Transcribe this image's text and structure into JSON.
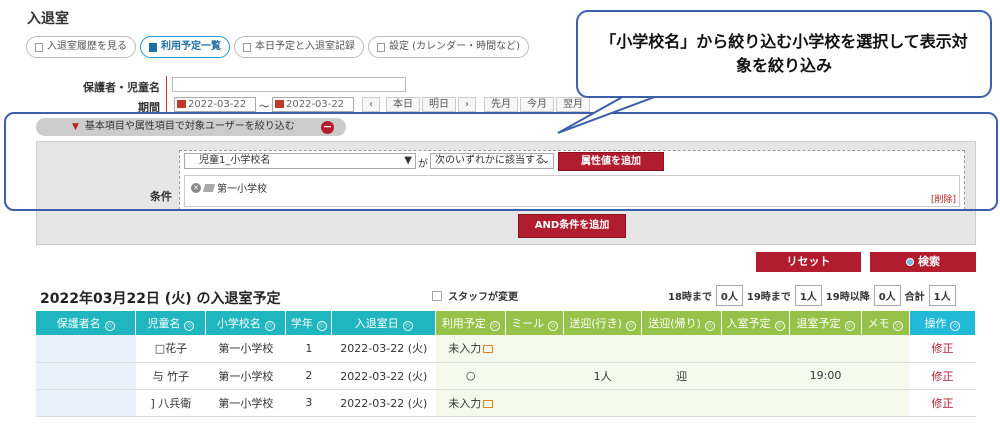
{
  "page_title": "入退室",
  "tabs": [
    {
      "label": "入退室履歴を見る"
    },
    {
      "label": "利用予定一覧"
    },
    {
      "label": "本日予定と入退室記録"
    },
    {
      "label": "設定 (カレンダー・時間など)"
    }
  ],
  "callout_text": "「小学校名」から絞り込む小学校を選択して表示対象を絞り込み",
  "form": {
    "name_label": "保護者・児童名",
    "period_label": "期間",
    "date_from": "2022-03-22",
    "date_sep": "〜",
    "date_to": "2022-03-22",
    "nav": [
      "‹",
      "本日",
      "明日",
      "›",
      "先月",
      "今月",
      "翌月"
    ]
  },
  "filter": {
    "header": "基本項目や属性項目で対象ユーザーを絞り込む",
    "condition_label": "条件",
    "attribute_select": "児童1_小学校名",
    "ga": "が",
    "match_select": "次のいずれかに該当する",
    "add_value_button": "属性値を追加",
    "selected_value": "第一小学校",
    "delete_link": "[削除]",
    "add_and_button": "AND条件を追加"
  },
  "reset_button": "リセット",
  "search_button": "検索",
  "schedule": {
    "title": "2022年03月22日 (火) の入退室予定",
    "staff_changed_label": "スタッフが変更",
    "counts": [
      {
        "label": "18時まで",
        "value": "0人"
      },
      {
        "label": "19時まで",
        "value": "1人"
      },
      {
        "label": "19時以降",
        "value": "0人"
      },
      {
        "label": "合計",
        "value": "1人"
      }
    ]
  },
  "table": {
    "headers": [
      "保護者名",
      "児童名",
      "小学校名",
      "学年",
      "入退室日",
      "利用予定",
      "ミール",
      "送迎(行き)",
      "送迎(帰り)",
      "入室予定",
      "退室予定",
      "メモ",
      "操作"
    ],
    "rows": [
      {
        "parent": "",
        "child": "□花子",
        "school": "第一小学校",
        "grade": "1",
        "date": "2022-03-22 (火)",
        "plan": "未入力",
        "meal": "",
        "pickup": "",
        "dropoff": "",
        "in": "",
        "out": "",
        "memo": "",
        "action": "修正"
      },
      {
        "parent": "",
        "child": "与 竹子",
        "school": "第一小学校",
        "grade": "2",
        "date": "2022-03-22 (火)",
        "plan": "○",
        "meal": "",
        "pickup": "1人",
        "dropoff": "迎",
        "in": "",
        "out": "19:00",
        "memo": "",
        "action": "修正"
      },
      {
        "parent": "",
        "child": "] 八兵衛",
        "school": "第一小学校",
        "grade": "3",
        "date": "2022-03-22 (火)",
        "plan": "未入力",
        "meal": "",
        "pickup": "",
        "dropoff": "",
        "in": "",
        "out": "",
        "memo": "",
        "action": "修正"
      }
    ]
  }
}
